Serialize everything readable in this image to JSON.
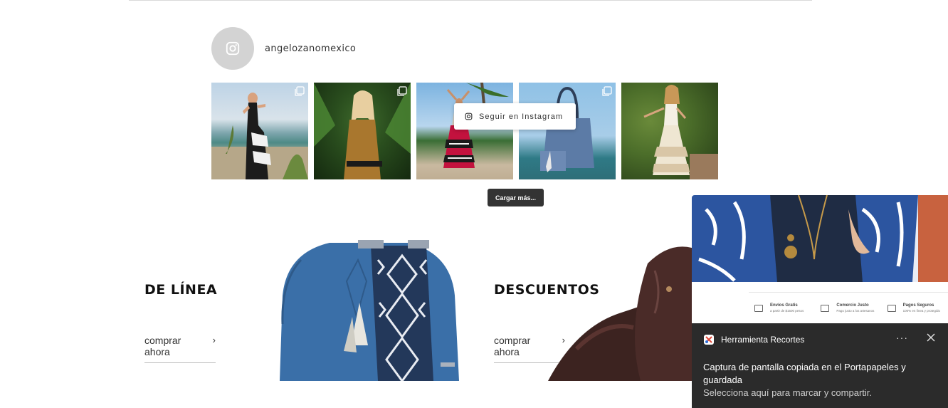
{
  "instagram": {
    "username": "angelozanomexico",
    "follow_label": "Seguir en Instagram",
    "load_more_label": "Cargar más..."
  },
  "promos": [
    {
      "title": "DE LÍNEA",
      "link": "comprar ahora"
    },
    {
      "title": "DESCUENTOS",
      "link": "comprar ahora"
    }
  ],
  "side_strip": [
    {
      "title": "Envíos Gratis",
      "sub": "a partir de $1500 pesos"
    },
    {
      "title": "Comercio Justo",
      "sub": "Pago justo a los artesanos"
    },
    {
      "title": "Pagos Seguros",
      "sub": "100% en línea y protegido"
    }
  ],
  "toast": {
    "app_name": "Herramienta Recortes",
    "more_label": "···",
    "message": "Captura de pantalla copiada en el Portapapeles y guardada",
    "hint": "Selecciona aquí para marcar y compartir."
  },
  "colors": {
    "accent_dark": "#333333",
    "toast_bg": "#2b2b2b",
    "avatar_gray": "#d3d3d3",
    "bag_blue": "#3a6fa8",
    "bag_brown": "#4a2b28",
    "panel_orange": "#c8623f"
  },
  "icons": [
    "instagram-icon",
    "multi-image-icon",
    "chevron-right-icon",
    "snipping-tool-icon",
    "more-icon",
    "close-icon"
  ]
}
